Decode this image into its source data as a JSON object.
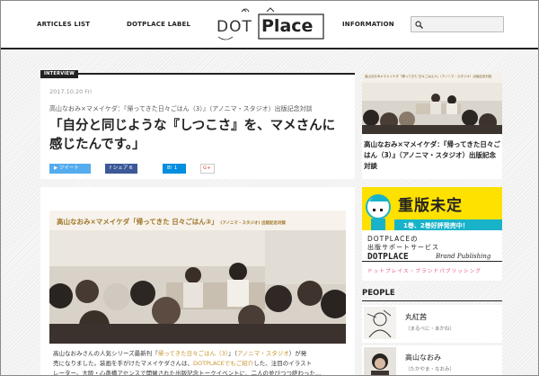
{
  "nav": {
    "articles_list": "ARTICLES LIST",
    "dotplace_label": "DOTPLACE LABEL",
    "information": "INFORMATION"
  },
  "logo": {
    "dot_text": "DOT",
    "place_text": "Place"
  },
  "search": {
    "placeholder": ""
  },
  "article": {
    "badge": "INTERVIEW",
    "date": "2017.10.20 Fri",
    "series": "高山なおみ×マメイケダ：『帰ってきた日々ごはん（3）』（アノニマ・スタジオ）出版記念対談",
    "title": "「自分と同じような『しつこさ』を、マメさんに感じたんです。」",
    "share": {
      "tweet": "ツイート",
      "facebook": "シェア",
      "facebook_count": "6",
      "hatena": "B!",
      "hatena_count": "1",
      "gplus": "G+"
    }
  },
  "side_article": {
    "caption": "高山なおみ×マメイケダ：『帰ってきた日々ごはん（3）』（アノニマ・スタジオ）出版記念対談",
    "image_header": "高山なおみ×マメイケダ「帰ってきた 日々ごはん③」（アノニマ・スタジオ）出版記念対談"
  },
  "banner": {
    "headline": "高山なおみ×マメイケダ「帰ってきた 日々ごはん③」",
    "headline_small": "(アノニマ・スタジオ) 出版記念対談"
  },
  "body": {
    "line1_prefix": "高山なおみさんの人気シリーズ最新刊『",
    "line1_link1": "帰ってきた日々ごはん（3）",
    "line1_mid": "』（",
    "line1_link2": "アノニマ・スタジオ",
    "line1_suffix": "）が発",
    "line2_prefix": "売になりました。装画を手がけたマメイケダさんは、",
    "line2_link": "DOTPLACEでもご紹介",
    "line2_suffix": "した、注目のイラスト",
    "line3": "レーター。大阪・心斎橋アセンスで開催された出版記念トークイベントに、二人の並びつつ終わった..."
  },
  "ad": {
    "title": "重版未定",
    "subtitle": "1巻、2巻好評発売中！",
    "line1": "DOTPLACEの",
    "line2": "出版サポートサービス",
    "brand": "DOTPLACE",
    "brand_script": "Brand Publishing",
    "kana": "ドットプレイス・ブランドパブリッシング"
  },
  "people": {
    "heading": "PEOPLE",
    "items": [
      {
        "name": "丸紅茜",
        "kana": "（まるべに・あかね）"
      },
      {
        "name": "高山なおみ",
        "kana": "（たかやま・なおみ）"
      }
    ]
  },
  "colors": {
    "twitter": "#55acee",
    "facebook": "#3b5998",
    "hatena": "#008fde",
    "ad_yellow": "#ffe100",
    "ad_teal": "#19b3c9",
    "ad_pink": "#e84b8a",
    "link": "#c7952e"
  }
}
